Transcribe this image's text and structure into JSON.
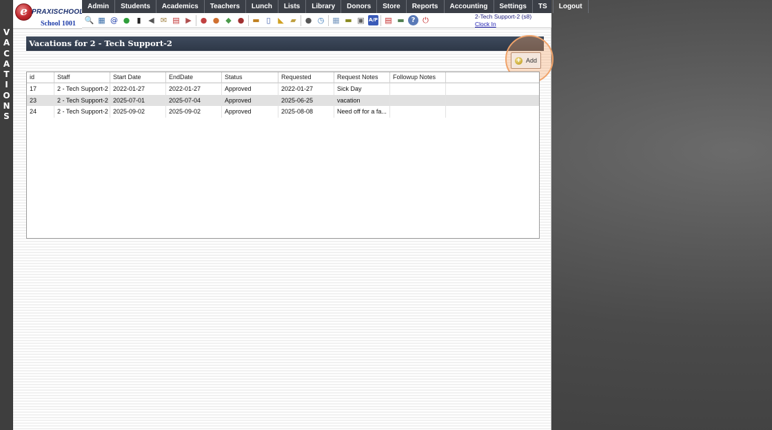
{
  "side_label": [
    "V",
    "A",
    "C",
    "A",
    "T",
    "I",
    "O",
    "N",
    "S"
  ],
  "logo": {
    "brand": "PRAXISCHOOL",
    "mark": "e",
    "school": "School 1001"
  },
  "nav": [
    "Admin",
    "Students",
    "Academics",
    "Teachers",
    "Lunch",
    "Lists",
    "Library",
    "Donors",
    "Store",
    "Reports",
    "Accounting",
    "Settings",
    "TS",
    "Logout"
  ],
  "toolbar_icons": [
    {
      "name": "search-icon",
      "glyph": "🔍",
      "color": "#666"
    },
    {
      "name": "table-icon",
      "glyph": "▦",
      "color": "#3a6ea8"
    },
    {
      "name": "email-icon",
      "glyph": "@",
      "color": "#1b3aa8"
    },
    {
      "name": "chat-icon",
      "glyph": "●",
      "color": "#2e9e3a"
    },
    {
      "name": "mobile-icon",
      "glyph": "▮",
      "color": "#222"
    },
    {
      "name": "speaker-icon",
      "glyph": "◀",
      "color": "#555"
    },
    {
      "name": "envelope-icon",
      "glyph": "✉",
      "color": "#a08040"
    },
    {
      "name": "calendar-icon",
      "glyph": "▤",
      "color": "#c03030"
    },
    {
      "name": "megaphone-icon",
      "glyph": "▶",
      "color": "#b05050"
    },
    {
      "name": "sep"
    },
    {
      "name": "user-red-icon",
      "glyph": "●",
      "color": "#c04040"
    },
    {
      "name": "user-orange-icon",
      "glyph": "●",
      "color": "#d07030"
    },
    {
      "name": "money-icon",
      "glyph": "◆",
      "color": "#4a9a4a"
    },
    {
      "name": "users-icon",
      "glyph": "●",
      "color": "#a03030"
    },
    {
      "name": "sep"
    },
    {
      "name": "lunch-icon",
      "glyph": "▬",
      "color": "#c08020"
    },
    {
      "name": "book-icon",
      "glyph": "▯",
      "color": "#3a5aa8"
    },
    {
      "name": "tag-icon",
      "glyph": "◣",
      "color": "#d0a020"
    },
    {
      "name": "ticket-icon",
      "glyph": "▰",
      "color": "#c0a040"
    },
    {
      "name": "sep"
    },
    {
      "name": "staff-icon",
      "glyph": "●",
      "color": "#555"
    },
    {
      "name": "clock-icon",
      "glyph": "◷",
      "color": "#3a7ab8"
    },
    {
      "name": "sep"
    },
    {
      "name": "grid-icon",
      "glyph": "▦",
      "color": "#7a9ac0"
    },
    {
      "name": "ruler-icon",
      "glyph": "▬",
      "color": "#8a8a20"
    },
    {
      "name": "printer-icon",
      "glyph": "▣",
      "color": "#606060"
    },
    {
      "name": "ap-icon",
      "glyph": "A/P",
      "color": "#ffffff",
      "bg": "#3a5ab8"
    },
    {
      "name": "sep"
    },
    {
      "name": "pdf-icon",
      "glyph": "▤",
      "color": "#c02020"
    },
    {
      "name": "cash-icon",
      "glyph": "▬",
      "color": "#508050"
    },
    {
      "name": "help-icon",
      "glyph": "?",
      "color": "#ffffff",
      "bg": "#5a7ab8"
    },
    {
      "name": "power-icon",
      "glyph": "⏻",
      "color": "#c02020"
    }
  ],
  "user": {
    "name": "2-Tech Support-2 (s8)",
    "clock_in": "Clock In"
  },
  "page_title": "Vacations for 2 - Tech Support-2",
  "add_button": "Add",
  "table": {
    "columns": [
      "id",
      "Staff",
      "Start Date",
      "EndDate",
      "Status",
      "Requested",
      "Request Notes",
      "Followup Notes"
    ],
    "rows": [
      [
        "17",
        "2 - Tech Support-2",
        "2022-01-27",
        "2022-01-27",
        "Approved",
        "2022-01-27",
        "Sick Day",
        ""
      ],
      [
        "23",
        "2 - Tech Support-2",
        "2025-07-01",
        "2025-07-04",
        "Approved",
        "2025-06-25",
        "vacation",
        ""
      ],
      [
        "24",
        "2 - Tech Support-2",
        "2025-09-02",
        "2025-09-02",
        "Approved",
        "2025-08-08",
        "Need off for a fa...",
        ""
      ]
    ]
  }
}
